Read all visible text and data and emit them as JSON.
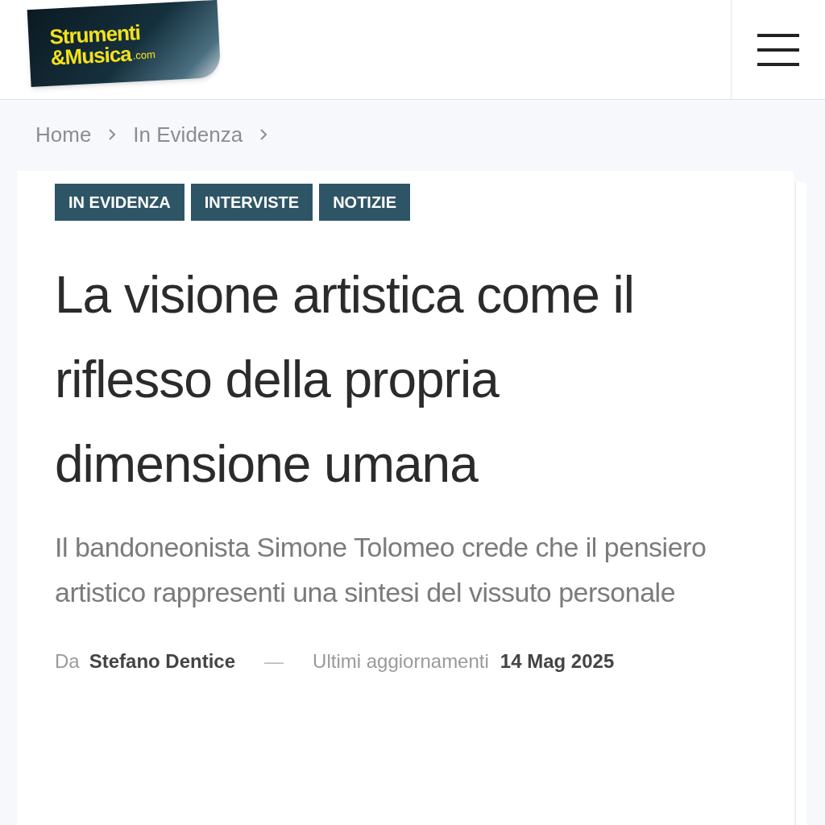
{
  "header": {
    "logo": {
      "line_1": "Strumenti",
      "line_2": "&Musica",
      "suffix": ".com"
    }
  },
  "breadcrumb": [
    "Home",
    "In Evidenza"
  ],
  "article": {
    "categories": [
      "IN EVIDENZA",
      "INTERVISTE",
      "NOTIZIE"
    ],
    "title": "La visione artistica come il riflesso della propria dimensione umana",
    "subtitle": "Il bandoneonista Simone Tolomeo crede che il pensiero artistico rappresenti una sintesi del vissuto personale",
    "byline": {
      "prefix": "Da",
      "author": "Stefano Dentice",
      "separator": "—",
      "updated_label": "Ultimi aggiornamenti",
      "date": "14 Mag 2025"
    }
  }
}
